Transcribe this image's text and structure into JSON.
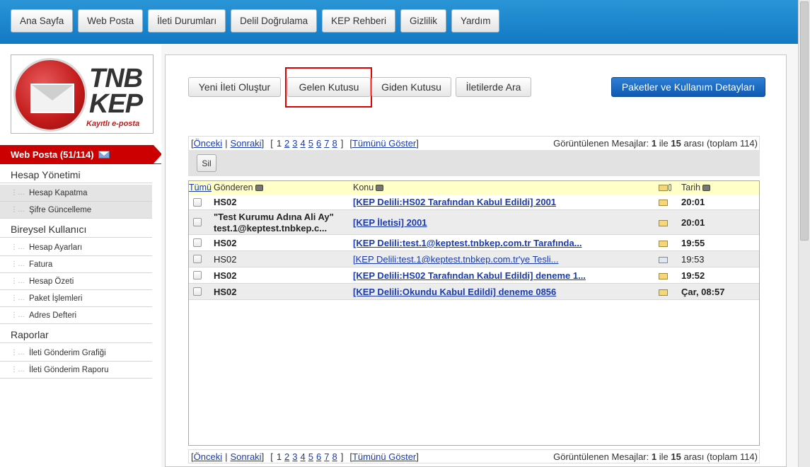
{
  "top_nav": [
    "Ana Sayfa",
    "Web Posta",
    "İleti Durumları",
    "Delil Doğrulama",
    "KEP Rehberi",
    "Gizlilik",
    "Yardım"
  ],
  "logo": {
    "line1": "TNB",
    "line2": "KEP",
    "tagline": "Kayıtlı e-posta"
  },
  "sidebar": {
    "web_posta": "Web Posta (51/114)",
    "sections": [
      {
        "title": "Hesap Yönetimi",
        "items": [
          "Hesap Kapatma",
          "Şifre Güncelleme"
        ]
      },
      {
        "title": "Bireysel Kullanıcı",
        "items": [
          "Hesap Ayarları",
          "Fatura",
          "Hesap Özeti",
          "Paket İşlemleri",
          "Adres Defteri"
        ]
      },
      {
        "title": "Raporlar",
        "items": [
          "İleti Gönderim Grafiği",
          "İleti Gönderim Raporu"
        ]
      }
    ]
  },
  "tabs": {
    "new_message": "Yeni İleti Oluştur",
    "inbox": "Gelen Kutusu",
    "outbox": "Giden Kutusu",
    "search": "İletilerde Ara",
    "package": "Paketler ve Kullanım Detayları"
  },
  "pager": {
    "open": "[",
    "prev": "Önceki",
    "sep": "|",
    "next": "Sonraki",
    "close": "]",
    "pages_open": "[",
    "pages": [
      "1",
      "2",
      "3",
      "4",
      "5",
      "6",
      "7",
      "8"
    ],
    "pages_close": "]",
    "show_all": "Tümünü Göster",
    "summary_prefix": "Görüntülenen Mesajlar:",
    "from": "1",
    "ile": "ile",
    "to": "15",
    "suffix": "arası (toplam 114)"
  },
  "toolbar": {
    "delete": "Sil"
  },
  "table": {
    "headers": {
      "all": "Tümü",
      "sender": "Gönderen",
      "subject": "Konu",
      "date": "Tarih"
    },
    "rows": [
      {
        "sender": "HS02",
        "subject": "[KEP Delili:HS02 Tarafından Kabul Edildi] 2001",
        "date": "20:01",
        "unread": true
      },
      {
        "sender": "\"Test Kurumu Adına Ali Ay\"",
        "sender2": "test.1@keptest.tnbkep.c...",
        "subject": "[KEP İletisi] 2001",
        "date": "20:01",
        "unread": true
      },
      {
        "sender": "HS02",
        "subject": "[KEP Delili:test.1@keptest.tnbkep.com.tr Tarafında...",
        "date": "19:55",
        "unread": true
      },
      {
        "sender": "HS02",
        "subject": "[KEP Delili:test.1@keptest.tnbkep.com.tr'ye Tesli...",
        "date": "19:53",
        "unread": false
      },
      {
        "sender": "HS02",
        "subject": "[KEP Delili:HS02 Tarafından Kabul Edildi] deneme 1...",
        "date": "19:52",
        "unread": true
      },
      {
        "sender": "HS02",
        "subject": "[KEP Delili:Okundu Kabul Edildi] deneme 0856",
        "date": "Çar, 08:57",
        "unread": true
      }
    ]
  }
}
